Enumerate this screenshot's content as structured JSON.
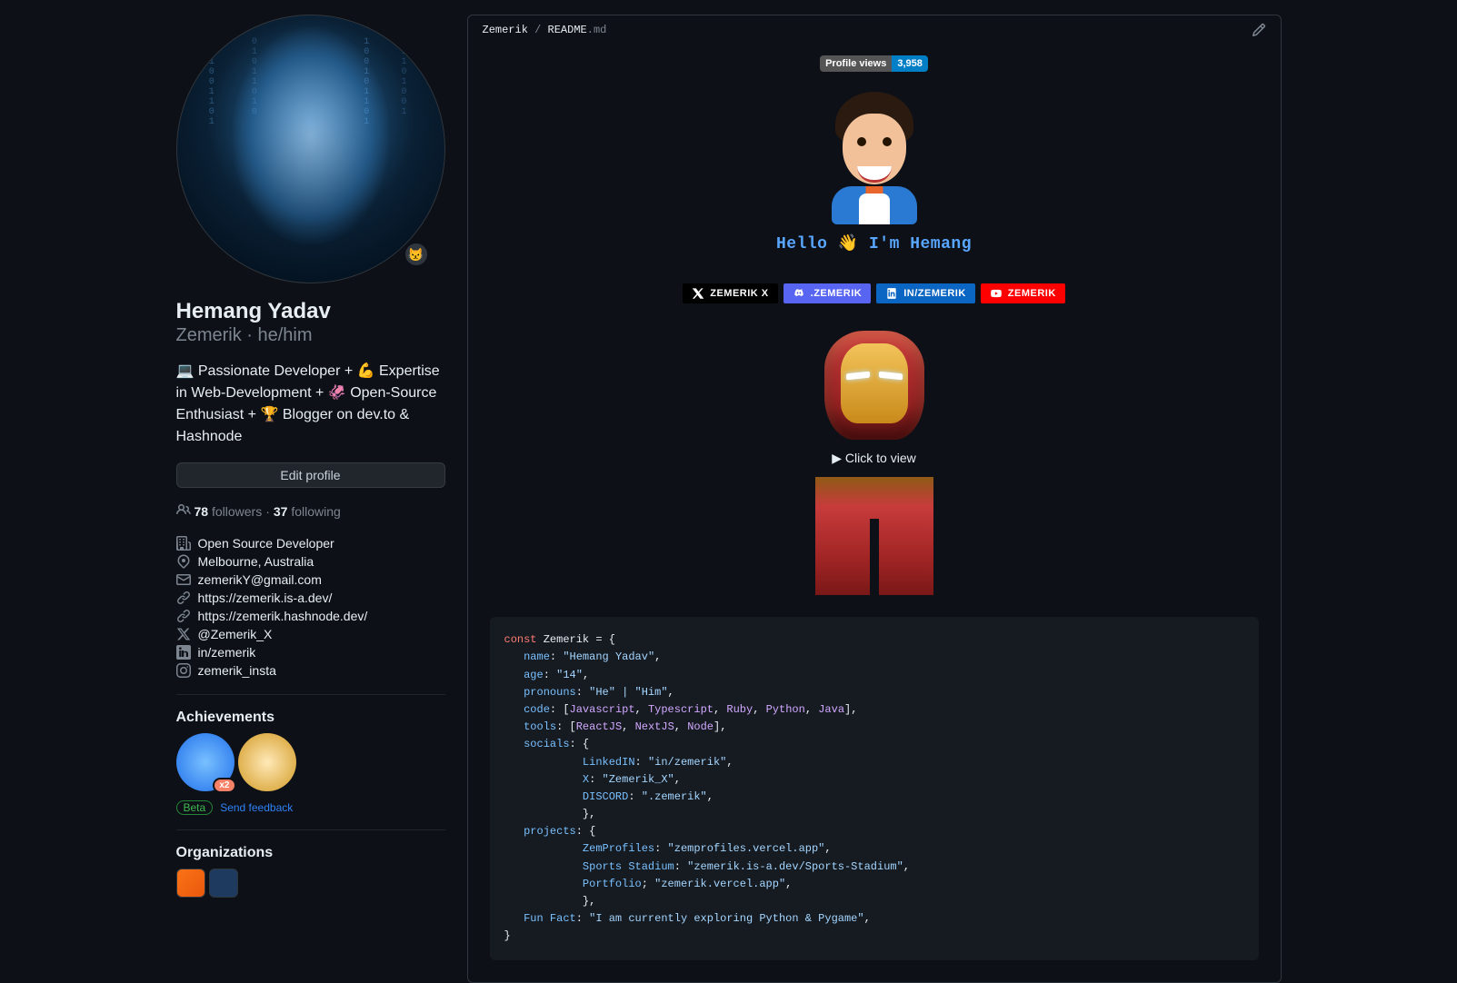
{
  "profile": {
    "name": "Hemang Yadav",
    "username": "Zemerik",
    "pronouns": "he/him",
    "subline": "Zemerik · he/him",
    "bio": "💻 Passionate Developer + 💪 Expertise in Web-Development + 🦑 Open-Source Enthusiast + 🏆 Blogger on dev.to & Hashnode",
    "edit_profile": "Edit profile",
    "followers_count": "78",
    "followers_label": "followers",
    "following_count": "37",
    "following_label": "following",
    "avatar_badge_emoji": "😾"
  },
  "details": {
    "company": "Open Source Developer",
    "location": "Melbourne, Australia",
    "email": "zemerikY@gmail.com",
    "website1": "https://zemerik.is-a.dev/",
    "website2": "https://zemerik.hashnode.dev/",
    "twitter": "@Zemerik_X",
    "linkedin": "in/zemerik",
    "instagram": "zemerik_insta"
  },
  "achievements": {
    "heading": "Achievements",
    "tier_label": "x2",
    "beta_label": "Beta",
    "feedback_label": "Send feedback"
  },
  "orgs": {
    "heading": "Organizations"
  },
  "readme": {
    "path_user": "Zemerik",
    "path_file": "README",
    "path_ext": ".md",
    "profile_views_label": "Profile views",
    "profile_views_count": "3,958",
    "hello": "Hello 👋 I'm Hemang",
    "click_to_view": "▶ Click to view",
    "socials": [
      {
        "label": "ZEMERIK X",
        "bg": "#000000",
        "icon": "x"
      },
      {
        "label": ".ZEMERIK",
        "bg": "#5865F2",
        "icon": "discord"
      },
      {
        "label": "IN/ZEMERIK",
        "bg": "#0A66C2",
        "icon": "linkedin"
      },
      {
        "label": "ZEMERIK",
        "bg": "#FF0000",
        "icon": "youtube"
      }
    ],
    "code": {
      "const": "const",
      "var": "Zemerik",
      "eq": "= {",
      "lines": [
        {
          "key": "name",
          "val": "\"Hemang Yadav\"",
          "trail": ","
        },
        {
          "key": "age",
          "val": "\"14\"",
          "trail": ","
        },
        {
          "key": "pronouns",
          "val": "\"He\" | \"Him\"",
          "trail": ","
        }
      ],
      "code_key": "code",
      "code_vals": [
        "Javascript",
        "Typescript",
        "Ruby",
        "Python",
        "Java"
      ],
      "tools_key": "tools",
      "tools_vals": [
        "ReactJS",
        "NextJS",
        "Node"
      ],
      "socials_key": "socials",
      "socials_obj": [
        {
          "key": "LinkedIN",
          "val": "\"in/zemerik\""
        },
        {
          "key": "X",
          "val": "\"Zemerik_X\""
        },
        {
          "key": "DISCORD",
          "val": "\".zemerik\""
        }
      ],
      "projects_key": "projects",
      "projects_obj": [
        {
          "key": "ZemProfiles",
          "val": "\"zemprofiles.vercel.app\"",
          "sep": ":"
        },
        {
          "key": "Sports Stadium",
          "val": "\"zemerik.is-a.dev/Sports-Stadium\"",
          "sep": ":"
        },
        {
          "key": "Portfolio",
          "val": "\"zemerik.vercel.app\"",
          "sep": ";"
        }
      ],
      "funfact_key": "Fun Fact",
      "funfact_val": "\"I am currently exploring Python & Pygame\"",
      "close": "}"
    }
  }
}
